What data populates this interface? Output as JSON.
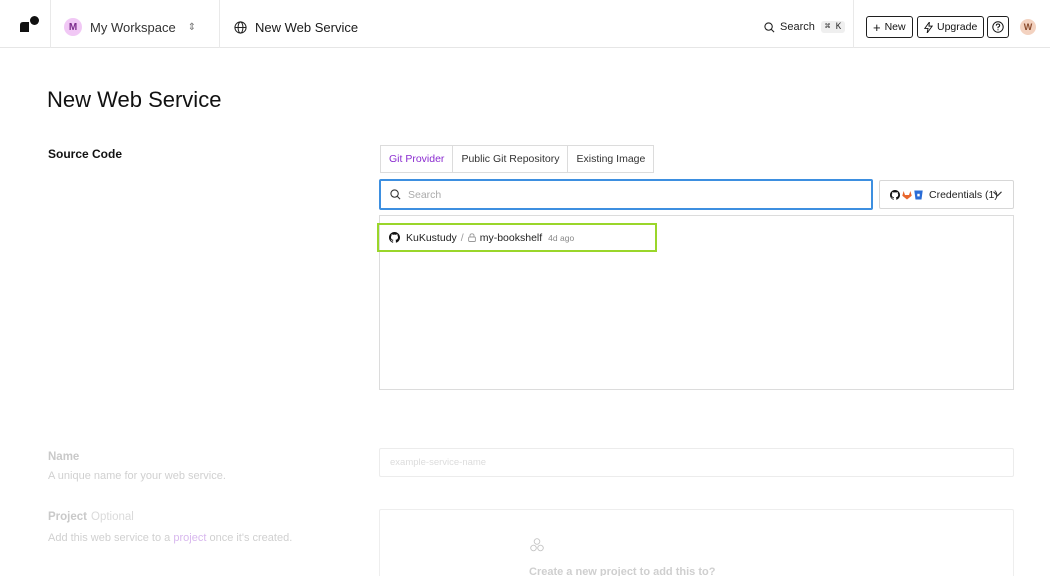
{
  "topbar": {
    "workspace_initial": "M",
    "workspace_name": "My Workspace",
    "breadcrumb": "New Web Service",
    "search_label": "Search",
    "search_shortcut": "⌘ K",
    "new_label": "New",
    "upgrade_label": "Upgrade",
    "user_initial": "W"
  },
  "page": {
    "title": "New Web Service"
  },
  "source_code": {
    "label": "Source Code",
    "tabs": [
      {
        "label": "Git Provider",
        "active": true
      },
      {
        "label": "Public Git Repository",
        "active": false
      },
      {
        "label": "Existing Image",
        "active": false
      }
    ],
    "search_placeholder": "Search",
    "credentials_label": "Credentials (1)",
    "repos": [
      {
        "owner": "KuKustudy",
        "name": "my-bookshelf",
        "updated": "4d ago"
      }
    ]
  },
  "name_section": {
    "label": "Name",
    "description": "A unique name for your web service.",
    "placeholder": "example-service-name"
  },
  "project_section": {
    "label": "Project",
    "optional": "Optional",
    "description_before": "Add this web service to a",
    "description_link": "project",
    "description_after": "once it's created.",
    "create_text": "Create a new project to add this to?"
  },
  "colors": {
    "accent_purple": "#8a2bd0",
    "focus_blue": "#3d8fe0",
    "highlight_green": "#9ad62a"
  }
}
